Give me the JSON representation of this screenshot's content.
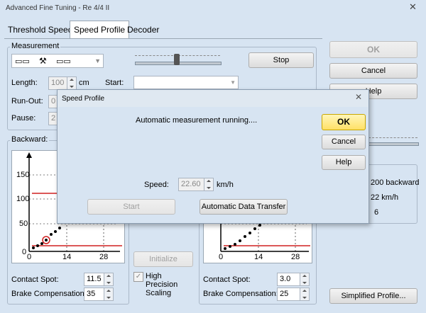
{
  "window": {
    "title": "Advanced Fine Tuning - Re 4/4 II"
  },
  "tabs": [
    {
      "label": "Threshold Speed"
    },
    {
      "label": "Speed Profile"
    },
    {
      "label": "Decoder"
    }
  ],
  "measurement": {
    "group_label": "Measurement",
    "length_label": "Length:",
    "length_value": "100",
    "length_unit": "cm",
    "runout_label": "Run-Out:",
    "runout_value": "0",
    "pause_label": "Pause:",
    "pause_value": "2",
    "start_label": "Start:",
    "start_value": "",
    "stop_label": "Stop"
  },
  "right_buttons": {
    "ok": "OK",
    "cancel": "Cancel",
    "help": "Help"
  },
  "backward": {
    "label": "Backward:",
    "contact_spot_label": "Contact Spot:",
    "contact_spot_value": "11.5",
    "brake_comp_label": "Brake Compensation:",
    "brake_comp_value": "35"
  },
  "forward": {
    "contact_spot_label": "Contact Spot:",
    "contact_spot_value": "3.0",
    "brake_comp_label": "Brake Compensation:",
    "brake_comp_value": "25"
  },
  "middle": {
    "initialize": "Initialize",
    "high_precision": [
      "High",
      "Precision",
      "Scaling"
    ]
  },
  "info": {
    "line1": "200 backward",
    "line2": "22 km/h",
    "line3": "6"
  },
  "simplified_profile": "Simplified Profile...",
  "chart_left": {
    "y_ticks": [
      "150",
      "100",
      "50",
      "0"
    ],
    "x_ticks": [
      "0",
      "14",
      "28"
    ]
  },
  "chart_right": {
    "x_ticks": [
      "0",
      "14",
      "28"
    ]
  },
  "dialog": {
    "title": "Speed Profile",
    "message": "Automatic measurement running....",
    "speed_label": "Speed:",
    "speed_value": "22.60",
    "speed_unit": "km/h",
    "start": "Start",
    "transfer": "Automatic Data Transfer",
    "ok": "OK",
    "cancel": "Cancel",
    "help": "Help"
  }
}
